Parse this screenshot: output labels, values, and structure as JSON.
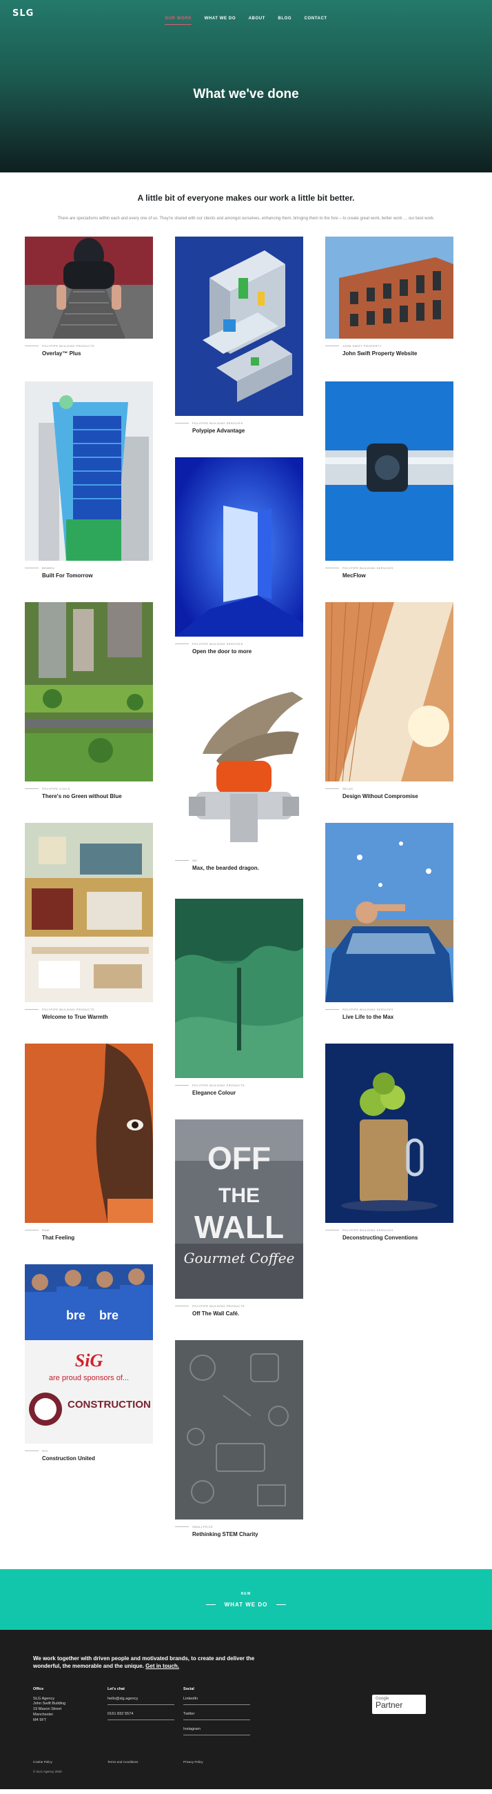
{
  "header": {
    "logo": "SLG",
    "nav": [
      "OUR WORK",
      "WHAT WE DO",
      "ABOUT",
      "BLOG",
      "CONTACT"
    ],
    "active_nav": "OUR WORK",
    "hero_title": "What we've done"
  },
  "intro": {
    "heading": "A little bit of everyone makes our work a little bit better.",
    "body": "There are specialisms within each and every one of us. They're shared with our clients and amongst ourselves, enhancing them, bringing them to the fore – to create great work, better work … our best work."
  },
  "projects": [
    {
      "category": "POLYPIPE BUILDING PRODUCTS",
      "title": "Overlay™ Plus"
    },
    {
      "category": "POLYPIPE BUILDING SERVICES",
      "title": "Polypipe Advantage"
    },
    {
      "category": "JOHN SWIFT PROPERTY",
      "title": "John Swift Property Website"
    },
    {
      "category": "BRIBRU",
      "title": "Built For Tomorrow"
    },
    {
      "category": "POLYPIPE BUILDING SERVICES",
      "title": "MecFlow"
    },
    {
      "category": "POLYPIPE BUILDING SERVICES",
      "title": "Open the door to more"
    },
    {
      "category": "POLYPIPE CIVILS",
      "title": "There's no Green without Blue"
    },
    {
      "category": "SELAS",
      "title": "Design Without Compromise"
    },
    {
      "category": "IMI",
      "title": "Max, the bearded dragon."
    },
    {
      "category": "POLYPIPE BUILDING PRODUCTS",
      "title": "Welcome to True Warmth"
    },
    {
      "category": "POLYPIPE BUILDING SERVICES",
      "title": "Live Life to the Max"
    },
    {
      "category": "POLYPIPE BUILDING PRODUCTS",
      "title": "Elegance Colour"
    },
    {
      "category": "RAW",
      "title": "That Feeling"
    },
    {
      "category": "POLYPIPE BUILDING SERVICES",
      "title": "Deconstructing Conventions"
    },
    {
      "category": "POLYPIPE BUILDING PRODUCTS",
      "title": "Off The Wall Café."
    },
    {
      "category": "SIG",
      "title": "Construction United"
    },
    {
      "category": "SMALLPEICE",
      "title": "Rethinking STEM Charity"
    }
  ],
  "image_text": {
    "sig_logo": "SiG",
    "sig_line": "are proud sponsors of...",
    "sig_cu": "CONSTRUCTION UNITED",
    "jersey": "bre",
    "offwall": [
      "OFF",
      "THE",
      "WALL",
      "Gourmet Coffee"
    ]
  },
  "cta": {
    "tag": "NEW",
    "label": "WHAT WE DO"
  },
  "footer": {
    "lead": "We work together with driven people and motivated brands, to create and deliver the wonderful, the memorable and the unique.",
    "lead_link": "Get in touch.",
    "office_title": "Office",
    "address": [
      "SLG Agency",
      "John Swift Building",
      "19 Mason Street",
      "Manchester",
      "M4 5FT"
    ],
    "chat_title": "Let's chat",
    "email": "hello@slg.agency",
    "phone": "0161 832 5574",
    "social_title": "Social",
    "social": [
      "LinkedIn",
      "Twitter",
      "Instagram"
    ],
    "partner_google": "Google",
    "partner_label": "Partner",
    "cookie": "Cookie Policy",
    "terms": "Terms and Conditions",
    "privacy": "Privacy Policy",
    "copyright": "© SLG Agency 2020"
  }
}
